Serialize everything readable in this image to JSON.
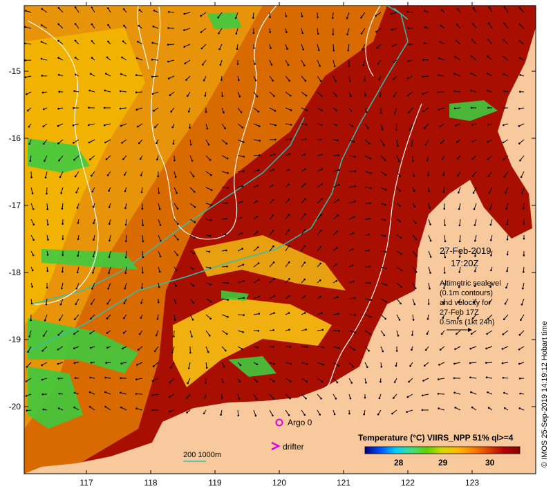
{
  "map": {
    "x_ticks": [
      "117",
      "118",
      "119",
      "120",
      "121",
      "122",
      "123"
    ],
    "y_ticks": [
      "-15",
      "-16",
      "-17",
      "-18",
      "-19",
      "-20"
    ]
  },
  "annotation": {
    "date": "27-Feb-2019",
    "time": "17:20Z",
    "altimetry_lines": [
      "Altimetric sealevel",
      "(0.1m contours)",
      "and velocity for",
      "27-Feb 17Z",
      "0.5m/s (1kt 24h)"
    ]
  },
  "legend": {
    "argo": "Argo 0",
    "drifter": "drifter",
    "scale": "200  1000m"
  },
  "colorbar": {
    "title": "Temperature (°C) VIIRS_NPP 51% ql>=4",
    "ticks": [
      "28",
      "29",
      "30"
    ],
    "colors": [
      "#00007f",
      "#0050ff",
      "#00d0ff",
      "#40e080",
      "#60d000",
      "#d8d800",
      "#ffb800",
      "#ff8000",
      "#e04000",
      "#b00000",
      "#8b0000"
    ]
  },
  "credit": "© IMOS 25-Sep-2019 14:19:12 Hobart time",
  "colors": {
    "land": "#f8c99c",
    "warm": "#a80f00",
    "mid": "#d96a00",
    "cool": "#f2b300",
    "green": "#3fca3f",
    "isobath": "#30c0b0",
    "contour": "#ffffff",
    "argo": "#e000e0"
  }
}
